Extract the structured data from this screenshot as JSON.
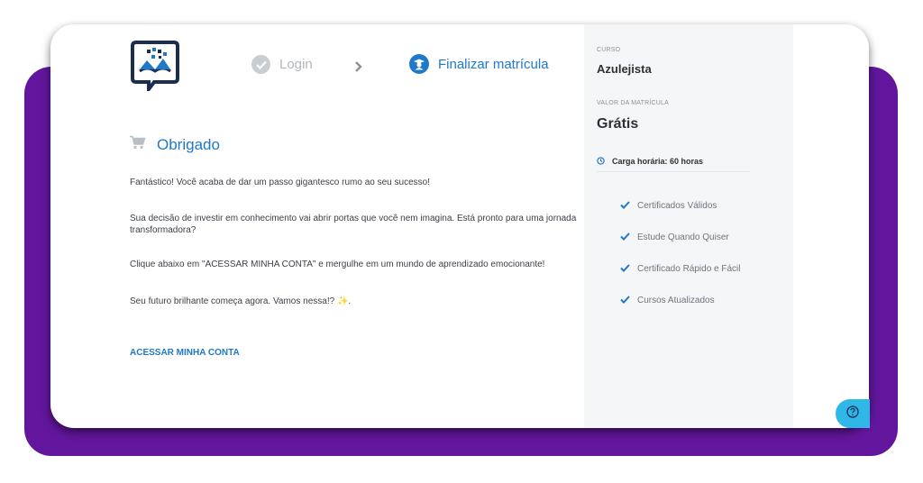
{
  "steps": {
    "login_label": "Login",
    "arrow": "›",
    "finalize_label": "Finalizar matrícula"
  },
  "main": {
    "title": "Obrigado",
    "paragraphs": [
      "Fantástico! Você acaba de dar um passo gigantesco rumo ao seu sucesso!",
      "Sua decisão de investir em conhecimento vai abrir portas que você nem imagina. Está pronto para uma jornada transformadora?",
      "Clique abaixo em \"ACESSAR MINHA CONTA\" e mergulhe em um mundo de aprendizado emocionante!",
      "Seu futuro brilhante começa agora. Vamos nessa!?"
    ],
    "sparkle": "✨",
    "sparkle_suffix": ".",
    "cta_label": "ACESSAR MINHA CONTA"
  },
  "sidebar": {
    "course_label": "CURSO",
    "course_name": "Azulejista",
    "price_label": "VALOR DA MATRÍCULA",
    "price": "Grátis",
    "hours": "Carga horária: 60 horas",
    "benefits": [
      "Certificados Válidos",
      "Estude Quando Quiser",
      "Certificado Rápido e Fácil",
      "Cursos Atualizados"
    ]
  },
  "icons": {
    "logo": "logo-icon",
    "login_step": "check-circle-icon",
    "arrow": "chevron-right-icon",
    "finalize_step": "user-graduate-icon",
    "heading": "shopping-cart-icon",
    "hours": "clock-icon",
    "benefit": "check-icon",
    "help": "question-circle-icon"
  },
  "colors": {
    "accent_blue": "#1f78c8",
    "purple_background": "#62169d",
    "help_button": "#2fb7e8",
    "sidebar_bg": "#f5f6f8"
  }
}
